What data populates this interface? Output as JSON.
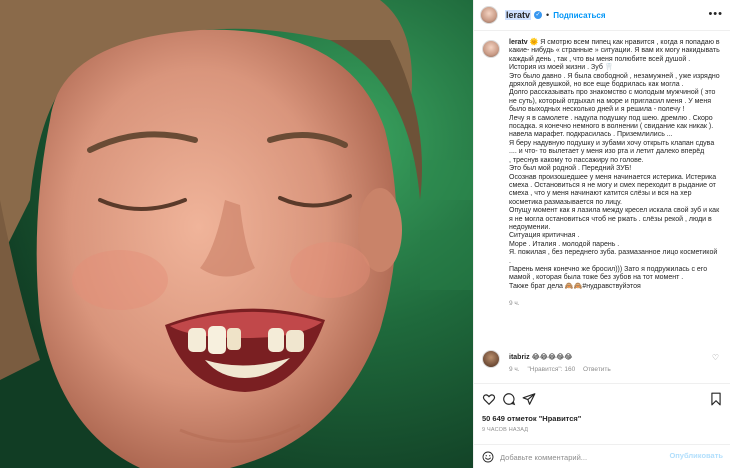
{
  "header": {
    "username": "leratv",
    "separator": "•",
    "follow_label": "Подписаться",
    "more_icon": "more-horizontal-icon",
    "verified_icon": "verified-icon"
  },
  "caption": {
    "username": "leratv",
    "lines": [
      "🌞 Я смотрю всем пипец как нравится , когда я попадаю в",
      "какие- нибудь « странные » ситуации. Я вам их могу накидывать",
      "каждый день , так , что вы меня полюбите всей душой .",
      "История из моей жизни . Зуб 🦷",
      "Это было давно . Я была свободной , незамужней , уже изрядно",
      "дряхлой девушкой, но все еще бодрилась как могла .",
      "Долго рассказывать про знакомство с молодым мужчиной ( это",
      "не суть), который отдыхал на море и пригласил меня . У меня",
      "было выходных несколько дней и я решила - полечу !",
      "Лечу я в самолете . надула подушку под шею. дремлю . Скоро",
      "посадка. я конечно немного в волнении ( свидание как никак ).",
      "навела марафет. подкрасилась . Приземлились ...",
      "Я беру надувную подушку и зубами хочу открыть клапан сдува",
      "....        и что- то вылетает у меня изо рта и летит далеко вперёд",
      ", треснув какому то пассажиру по голове.",
      "Это был мой родной . Передний ЗУБ!",
      "Осознав произошедшее у меня начинается истерика. Истерика",
      "смеха . Остановиться я не могу и смех переходит в рыдание от",
      "смеха , что у меня начинают катится слёзы и вся на хер",
      "косметика размазывается по лицу.",
      "Опущу момент как я лазила между кресел искала свой зуб и как",
      "я не могла остановиться чтоб не ржать . слёзы рекой , люди в",
      "недоумении.",
      "Ситуация критичная .",
      "Море . Италия . молодой парень .",
      "Я. пожилая , без переднего зуба. размазанное лицо косметикой",
      ".",
      "Парень меня конечно же бросил))) Зато я подружилась с его",
      "мамой , которая была тоже без зубов на тот момент .",
      "Также брат дела 🙈🙈#нудравствуйэтоя"
    ],
    "time": "9 ч."
  },
  "reply": {
    "username": "itabriz",
    "text": "😂😂😂😂😂",
    "time": "9 ч.",
    "likes": "\"Нравится\": 160",
    "reply_label": "Ответить",
    "like_icon": "heart-outline-icon"
  },
  "actions": {
    "like_icon": "heart-outline-icon",
    "comment_icon": "comment-icon",
    "share_icon": "paper-plane-icon",
    "save_icon": "bookmark-icon"
  },
  "likes": {
    "count": "50 649",
    "label": "отметок \"Нравится\""
  },
  "post_time": "9 ЧАСОВ НАЗАД",
  "add_comment": {
    "placeholder": "Добавьте комментарий...",
    "publish_label": "Опубликовать",
    "emoji_icon": "smile-icon"
  }
}
